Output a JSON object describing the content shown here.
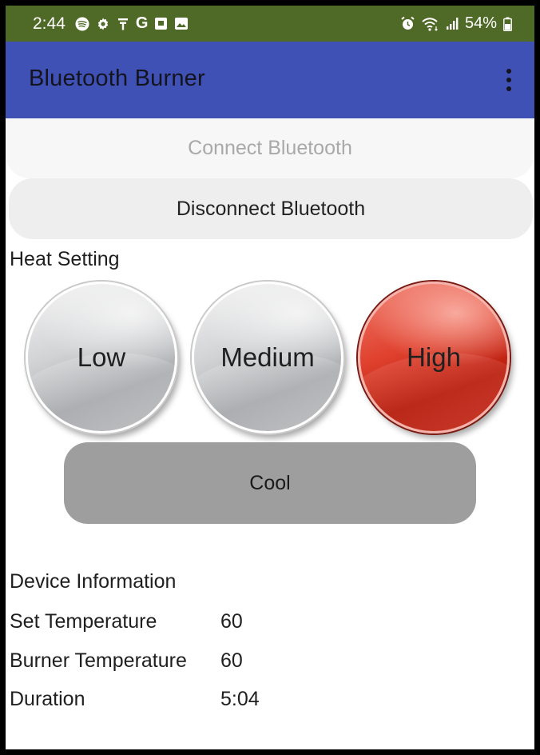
{
  "status_bar": {
    "time": "2:44",
    "battery_percent": "54%",
    "left_icons": [
      "spotify-icon",
      "settings-icon",
      "wifi-usb-icon",
      "google-icon",
      "notification-box-icon",
      "image-icon"
    ],
    "right_icons": [
      "alarm-icon",
      "wifi-icon",
      "signal-icon",
      "battery-icon"
    ],
    "left_letter": "G"
  },
  "app_bar": {
    "title": "Bluetooth Burner"
  },
  "buttons": {
    "connect": "Connect Bluetooth",
    "disconnect": "Disconnect Bluetooth",
    "cool": "Cool"
  },
  "heat": {
    "label": "Heat Setting",
    "options": [
      "Low",
      "Medium",
      "High"
    ],
    "selected": "High"
  },
  "device": {
    "title": "Device Information",
    "rows": [
      {
        "key": "Set Temperature",
        "value": "60"
      },
      {
        "key": "Burner Temperature",
        "value": "60"
      },
      {
        "key": "Duration",
        "value": "5:04"
      }
    ]
  },
  "colors": {
    "status_bar": "#4f6a26",
    "app_bar": "#3f51b5",
    "selected_heat": "#e0422f",
    "cool_button": "#9e9e9e"
  }
}
